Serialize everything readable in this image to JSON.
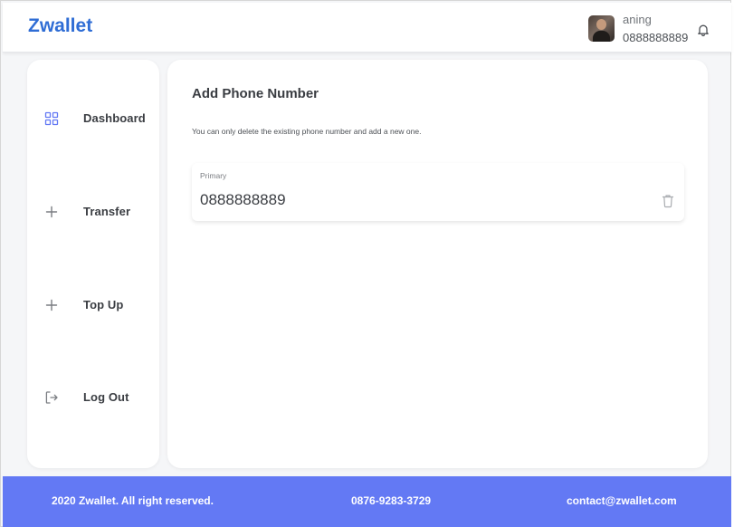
{
  "header": {
    "brand": "Zwallet",
    "user": {
      "name": "aning",
      "phone": "0888888889"
    },
    "icons": {
      "notification": "bell-icon",
      "avatar": "profile-photo"
    }
  },
  "sidebar": {
    "items": [
      {
        "label": "Dashboard",
        "icon": "grid-icon",
        "active": true
      },
      {
        "label": "Transfer",
        "icon": "plus-icon",
        "active": false
      },
      {
        "label": "Top Up",
        "icon": "plus-icon",
        "active": false
      },
      {
        "label": "Log Out",
        "icon": "logout-icon",
        "active": false
      }
    ]
  },
  "main": {
    "title": "Add Phone Number",
    "description": "You can only delete the existing phone number and add a new one.",
    "phone_card": {
      "label": "Primary",
      "number": "0888888889",
      "delete_icon": "trash-icon"
    }
  },
  "footer": {
    "copyright": "2020 Zwallet. All right reserved.",
    "phone": "0876-9283-3729",
    "email": "contact@zwallet.com"
  },
  "colors": {
    "brand": "#2f6dd5",
    "accent": "#6379f4",
    "background": "#f5f6f8",
    "text": "#3a3d42"
  }
}
